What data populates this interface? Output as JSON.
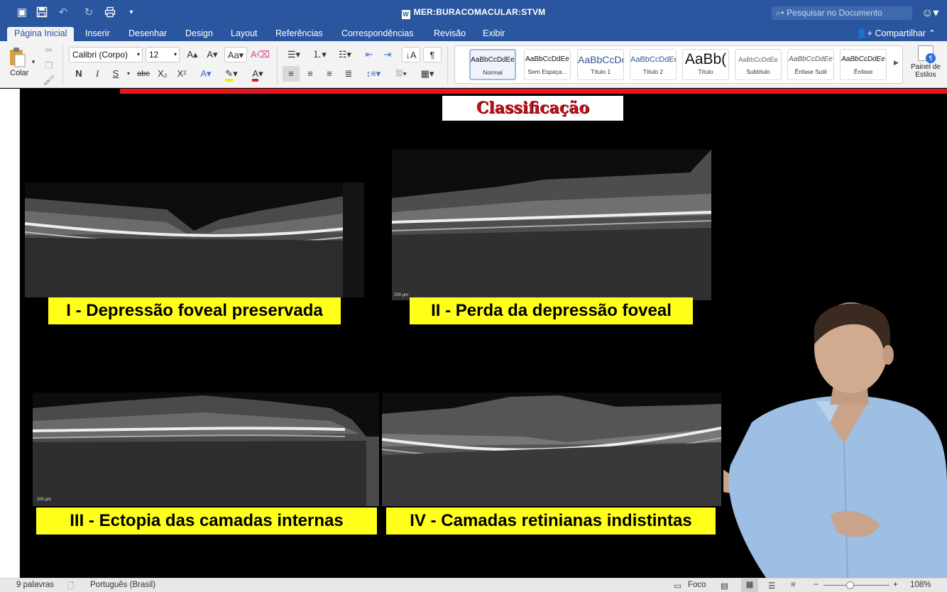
{
  "window": {
    "title": "MER:BURACOMACULAR:STVM",
    "search_placeholder": "Pesquisar no Documento"
  },
  "tabs": [
    "Página Inicial",
    "Inserir",
    "Desenhar",
    "Design",
    "Layout",
    "Referências",
    "Correspondências",
    "Revisão",
    "Exibir"
  ],
  "share_label": "Compartilhar",
  "ribbon": {
    "paste_label": "Colar",
    "font_name": "Calibri (Corpo)",
    "font_size": "12",
    "bold": "N",
    "italic": "I",
    "underline": "S",
    "strike": "abc",
    "subscript": "X₂",
    "superscript": "X²",
    "styles": [
      {
        "sample": "AaBbCcDdEe",
        "name": "Normal"
      },
      {
        "sample": "AaBbCcDdEe",
        "name": "Sem Espaça..."
      },
      {
        "sample": "AaBbCcDc",
        "name": "Título 1"
      },
      {
        "sample": "AaBbCcDdEe",
        "name": "Título 2"
      },
      {
        "sample": "AaBb(",
        "name": "Título"
      },
      {
        "sample": "AaBbCcDdEe",
        "name": "Subtítulo"
      },
      {
        "sample": "AaBbCcDdEe",
        "name": "Ênfase Sutil"
      },
      {
        "sample": "AaBbCcDdEe",
        "name": "Ênfase"
      }
    ],
    "styles_pane_label": "Painel de Estilos"
  },
  "slide": {
    "title": "Classificação",
    "captions": [
      "I - Depressão foveal preservada",
      "II - Perda da depressão foveal",
      "III - Ectopia das camadas internas",
      "IV - Camadas retinianas indistintas"
    ],
    "scale_label": "200 µm"
  },
  "statusbar": {
    "words": "9 palavras",
    "language": "Português (Brasil)",
    "focus": "Foco",
    "zoom": "108%",
    "zoom_fraction": 0.4
  },
  "colors": {
    "titlebar": "#2a569f",
    "ribbon": "#f3f3f3",
    "caption_bg": "#ffff1a",
    "title_red": "#c0101a",
    "red_bar": "#e8161b"
  }
}
